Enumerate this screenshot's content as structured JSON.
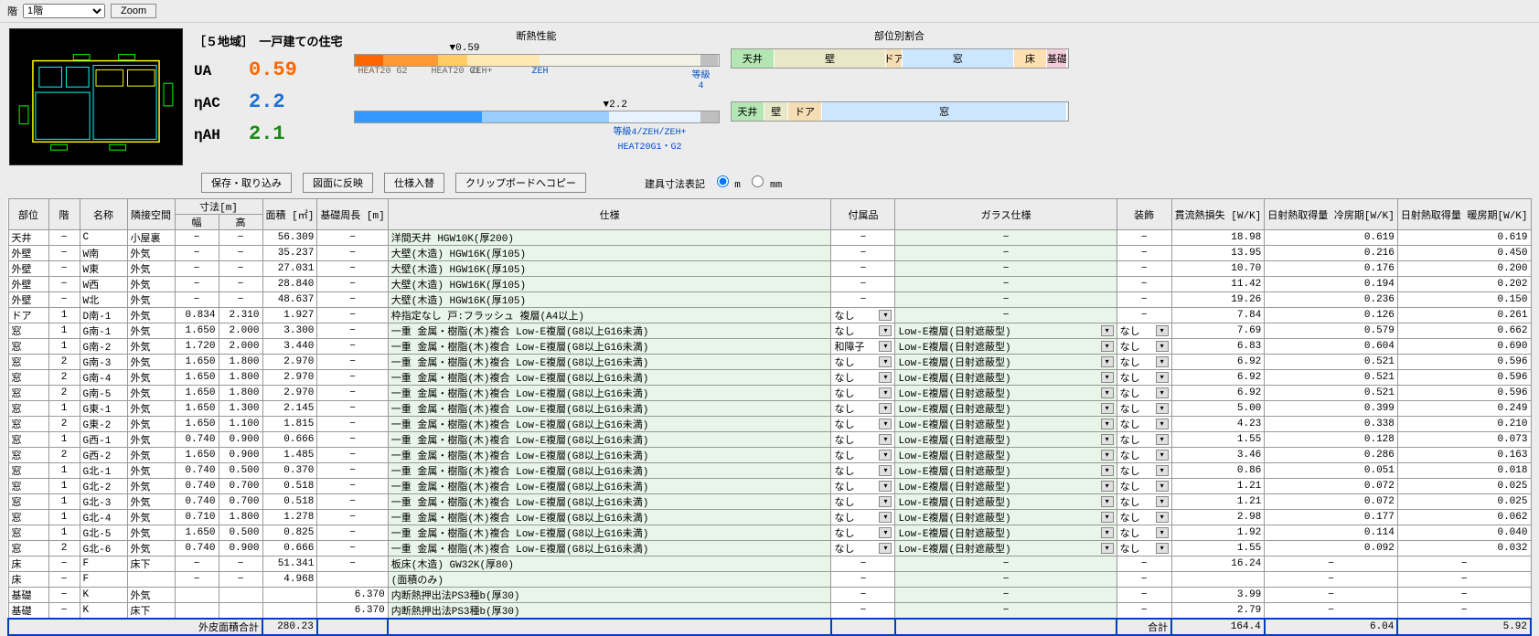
{
  "topbar": {
    "floor_label": "階",
    "floor_selected": "1階",
    "zoom": "Zoom"
  },
  "summary": {
    "title": "［５地域］　一戸建ての住宅",
    "ua_label": "UA",
    "ua_value": "0.59",
    "nac_label": "ηAC",
    "nac_value": "2.2",
    "nah_label": "ηAH",
    "nah_value": "2.1"
  },
  "gauge_ua": {
    "title": "断熱性能",
    "marker": "▼0.59",
    "ticks": [
      "HEAT20 G2",
      "HEAT20 G1",
      "ZEH+",
      "ZEH",
      "等級4"
    ]
  },
  "gauge_ac": {
    "marker": "▼2.2",
    "tick": "等級4/ZEH/ZEH+ HEAT20G1・G2"
  },
  "prop": {
    "title": "部位別割合",
    "bar1": [
      "天井",
      "壁",
      "ドア",
      "窓",
      "床",
      "基礎"
    ],
    "bar2": [
      "天井",
      "壁",
      "ドア",
      "窓"
    ]
  },
  "buttons": {
    "save": "保存・取り込み",
    "reflect": "図面に反映",
    "swap": "仕様入替",
    "clip": "クリップボードへコピー"
  },
  "radio": {
    "label": "建具寸法表記",
    "opt_m": "m",
    "opt_mm": "mm"
  },
  "headers": {
    "bui": "部位",
    "floor": "階",
    "name": "名称",
    "adj": "隣接空間",
    "dim": "寸法[m]",
    "dim_w": "幅",
    "dim_h": "高",
    "area": "面積 [㎡]",
    "peri": "基礎周長 [m]",
    "spec": "仕様",
    "acc": "付属品",
    "glass": "ガラス仕様",
    "deco": "装飾",
    "loss": "貫流熱損失 [W/K]",
    "cool": "日射熱取得量 冷房期[W/K]",
    "heat": "日射熱取得量 暖房期[W/K]"
  },
  "rows": [
    {
      "bui": "天井",
      "floor": "−",
      "name": "C",
      "adj": "小屋裏",
      "w": "−",
      "h": "−",
      "area": "56.309",
      "peri": "−",
      "spec": "洋間天井 HGW10K(厚200)",
      "acc": "−",
      "glass": "−",
      "deco": "−",
      "loss": "18.98",
      "cool": "0.619",
      "heat": "0.619"
    },
    {
      "bui": "外壁",
      "floor": "−",
      "name": "W南",
      "adj": "外気",
      "w": "−",
      "h": "−",
      "area": "35.237",
      "peri": "−",
      "spec": "大壁(木造) HGW16K(厚105)",
      "acc": "−",
      "glass": "−",
      "deco": "−",
      "loss": "13.95",
      "cool": "0.216",
      "heat": "0.450"
    },
    {
      "bui": "外壁",
      "floor": "−",
      "name": "W東",
      "adj": "外気",
      "w": "−",
      "h": "−",
      "area": "27.031",
      "peri": "−",
      "spec": "大壁(木造) HGW16K(厚105)",
      "acc": "−",
      "glass": "−",
      "deco": "−",
      "loss": "10.70",
      "cool": "0.176",
      "heat": "0.200"
    },
    {
      "bui": "外壁",
      "floor": "−",
      "name": "W西",
      "adj": "外気",
      "w": "−",
      "h": "−",
      "area": "28.840",
      "peri": "−",
      "spec": "大壁(木造) HGW16K(厚105)",
      "acc": "−",
      "glass": "−",
      "deco": "−",
      "loss": "11.42",
      "cool": "0.194",
      "heat": "0.202"
    },
    {
      "bui": "外壁",
      "floor": "−",
      "name": "W北",
      "adj": "外気",
      "w": "−",
      "h": "−",
      "area": "48.637",
      "peri": "−",
      "spec": "大壁(木造) HGW16K(厚105)",
      "acc": "−",
      "glass": "−",
      "deco": "−",
      "loss": "19.26",
      "cool": "0.236",
      "heat": "0.150"
    },
    {
      "bui": "ドア",
      "floor": "1",
      "name": "D南-1",
      "adj": "外気",
      "w": "0.834",
      "h": "2.310",
      "area": "1.927",
      "peri": "−",
      "spec": "枠指定なし 戸:フラッシュ 複層(A4以上)",
      "acc": "なし",
      "acc_dd": true,
      "glass": "−",
      "deco": "−",
      "loss": "7.84",
      "cool": "0.126",
      "heat": "0.261"
    },
    {
      "bui": "窓",
      "floor": "1",
      "name": "G南-1",
      "adj": "外気",
      "w": "1.650",
      "h": "2.000",
      "area": "3.300",
      "peri": "−",
      "spec": "一重 金属・樹脂(木)複合 Low-E複層(G8以上G16未満)",
      "acc": "なし",
      "acc_dd": true,
      "glass": "Low-E複層(日射遮蔽型)",
      "glass_dd": true,
      "deco": "なし",
      "deco_dd": true,
      "loss": "7.69",
      "cool": "0.579",
      "heat": "0.662"
    },
    {
      "bui": "窓",
      "floor": "1",
      "name": "G南-2",
      "adj": "外気",
      "w": "1.720",
      "h": "2.000",
      "area": "3.440",
      "peri": "−",
      "spec": "一重 金属・樹脂(木)複合 Low-E複層(G8以上G16未満)",
      "acc": "和障子",
      "acc_dd": true,
      "glass": "Low-E複層(日射遮蔽型)",
      "glass_dd": true,
      "deco": "なし",
      "deco_dd": true,
      "loss": "6.83",
      "cool": "0.604",
      "heat": "0.690"
    },
    {
      "bui": "窓",
      "floor": "2",
      "name": "G南-3",
      "adj": "外気",
      "w": "1.650",
      "h": "1.800",
      "area": "2.970",
      "peri": "−",
      "spec": "一重 金属・樹脂(木)複合 Low-E複層(G8以上G16未満)",
      "acc": "なし",
      "acc_dd": true,
      "glass": "Low-E複層(日射遮蔽型)",
      "glass_dd": true,
      "deco": "なし",
      "deco_dd": true,
      "loss": "6.92",
      "cool": "0.521",
      "heat": "0.596"
    },
    {
      "bui": "窓",
      "floor": "2",
      "name": "G南-4",
      "adj": "外気",
      "w": "1.650",
      "h": "1.800",
      "area": "2.970",
      "peri": "−",
      "spec": "一重 金属・樹脂(木)複合 Low-E複層(G8以上G16未満)",
      "acc": "なし",
      "acc_dd": true,
      "glass": "Low-E複層(日射遮蔽型)",
      "glass_dd": true,
      "deco": "なし",
      "deco_dd": true,
      "loss": "6.92",
      "cool": "0.521",
      "heat": "0.596"
    },
    {
      "bui": "窓",
      "floor": "2",
      "name": "G南-5",
      "adj": "外気",
      "w": "1.650",
      "h": "1.800",
      "area": "2.970",
      "peri": "−",
      "spec": "一重 金属・樹脂(木)複合 Low-E複層(G8以上G16未満)",
      "acc": "なし",
      "acc_dd": true,
      "glass": "Low-E複層(日射遮蔽型)",
      "glass_dd": true,
      "deco": "なし",
      "deco_dd": true,
      "loss": "6.92",
      "cool": "0.521",
      "heat": "0.596"
    },
    {
      "bui": "窓",
      "floor": "1",
      "name": "G東-1",
      "adj": "外気",
      "w": "1.650",
      "h": "1.300",
      "area": "2.145",
      "peri": "−",
      "spec": "一重 金属・樹脂(木)複合 Low-E複層(G8以上G16未満)",
      "acc": "なし",
      "acc_dd": true,
      "glass": "Low-E複層(日射遮蔽型)",
      "glass_dd": true,
      "deco": "なし",
      "deco_dd": true,
      "loss": "5.00",
      "cool": "0.399",
      "heat": "0.249"
    },
    {
      "bui": "窓",
      "floor": "2",
      "name": "G東-2",
      "adj": "外気",
      "w": "1.650",
      "h": "1.100",
      "area": "1.815",
      "peri": "−",
      "spec": "一重 金属・樹脂(木)複合 Low-E複層(G8以上G16未満)",
      "acc": "なし",
      "acc_dd": true,
      "glass": "Low-E複層(日射遮蔽型)",
      "glass_dd": true,
      "deco": "なし",
      "deco_dd": true,
      "loss": "4.23",
      "cool": "0.338",
      "heat": "0.210"
    },
    {
      "bui": "窓",
      "floor": "1",
      "name": "G西-1",
      "adj": "外気",
      "w": "0.740",
      "h": "0.900",
      "area": "0.666",
      "peri": "−",
      "spec": "一重 金属・樹脂(木)複合 Low-E複層(G8以上G16未満)",
      "acc": "なし",
      "acc_dd": true,
      "glass": "Low-E複層(日射遮蔽型)",
      "glass_dd": true,
      "deco": "なし",
      "deco_dd": true,
      "loss": "1.55",
      "cool": "0.128",
      "heat": "0.073"
    },
    {
      "bui": "窓",
      "floor": "2",
      "name": "G西-2",
      "adj": "外気",
      "w": "1.650",
      "h": "0.900",
      "area": "1.485",
      "peri": "−",
      "spec": "一重 金属・樹脂(木)複合 Low-E複層(G8以上G16未満)",
      "acc": "なし",
      "acc_dd": true,
      "glass": "Low-E複層(日射遮蔽型)",
      "glass_dd": true,
      "deco": "なし",
      "deco_dd": true,
      "loss": "3.46",
      "cool": "0.286",
      "heat": "0.163"
    },
    {
      "bui": "窓",
      "floor": "1",
      "name": "G北-1",
      "adj": "外気",
      "w": "0.740",
      "h": "0.500",
      "area": "0.370",
      "peri": "−",
      "spec": "一重 金属・樹脂(木)複合 Low-E複層(G8以上G16未満)",
      "acc": "なし",
      "acc_dd": true,
      "glass": "Low-E複層(日射遮蔽型)",
      "glass_dd": true,
      "deco": "なし",
      "deco_dd": true,
      "loss": "0.86",
      "cool": "0.051",
      "heat": "0.018"
    },
    {
      "bui": "窓",
      "floor": "1",
      "name": "G北-2",
      "adj": "外気",
      "w": "0.740",
      "h": "0.700",
      "area": "0.518",
      "peri": "−",
      "spec": "一重 金属・樹脂(木)複合 Low-E複層(G8以上G16未満)",
      "acc": "なし",
      "acc_dd": true,
      "glass": "Low-E複層(日射遮蔽型)",
      "glass_dd": true,
      "deco": "なし",
      "deco_dd": true,
      "loss": "1.21",
      "cool": "0.072",
      "heat": "0.025"
    },
    {
      "bui": "窓",
      "floor": "1",
      "name": "G北-3",
      "adj": "外気",
      "w": "0.740",
      "h": "0.700",
      "area": "0.518",
      "peri": "−",
      "spec": "一重 金属・樹脂(木)複合 Low-E複層(G8以上G16未満)",
      "acc": "なし",
      "acc_dd": true,
      "glass": "Low-E複層(日射遮蔽型)",
      "glass_dd": true,
      "deco": "なし",
      "deco_dd": true,
      "loss": "1.21",
      "cool": "0.072",
      "heat": "0.025"
    },
    {
      "bui": "窓",
      "floor": "1",
      "name": "G北-4",
      "adj": "外気",
      "w": "0.710",
      "h": "1.800",
      "area": "1.278",
      "peri": "−",
      "spec": "一重 金属・樹脂(木)複合 Low-E複層(G8以上G16未満)",
      "acc": "なし",
      "acc_dd": true,
      "glass": "Low-E複層(日射遮蔽型)",
      "glass_dd": true,
      "deco": "なし",
      "deco_dd": true,
      "loss": "2.98",
      "cool": "0.177",
      "heat": "0.062"
    },
    {
      "bui": "窓",
      "floor": "1",
      "name": "G北-5",
      "adj": "外気",
      "w": "1.650",
      "h": "0.500",
      "area": "0.825",
      "peri": "−",
      "spec": "一重 金属・樹脂(木)複合 Low-E複層(G8以上G16未満)",
      "acc": "なし",
      "acc_dd": true,
      "glass": "Low-E複層(日射遮蔽型)",
      "glass_dd": true,
      "deco": "なし",
      "deco_dd": true,
      "loss": "1.92",
      "cool": "0.114",
      "heat": "0.040"
    },
    {
      "bui": "窓",
      "floor": "2",
      "name": "G北-6",
      "adj": "外気",
      "w": "0.740",
      "h": "0.900",
      "area": "0.666",
      "peri": "−",
      "spec": "一重 金属・樹脂(木)複合 Low-E複層(G8以上G16未満)",
      "acc": "なし",
      "acc_dd": true,
      "glass": "Low-E複層(日射遮蔽型)",
      "glass_dd": true,
      "deco": "なし",
      "deco_dd": true,
      "loss": "1.55",
      "cool": "0.092",
      "heat": "0.032"
    },
    {
      "bui": "床",
      "floor": "−",
      "name": "F",
      "adj": "床下",
      "w": "−",
      "h": "−",
      "area": "51.341",
      "peri": "−",
      "spec": "板床(木造) GW32K(厚80)",
      "acc": "−",
      "glass": "−",
      "deco": "−",
      "loss": "16.24",
      "cool": "−",
      "heat": "−"
    },
    {
      "bui": "床",
      "floor": "−",
      "name": "F",
      "adj": "",
      "w": "−",
      "h": "−",
      "area": "4.968",
      "peri": "",
      "spec": "(面積のみ)",
      "acc": "−",
      "glass": "−",
      "deco": "−",
      "loss": "",
      "cool": "−",
      "heat": "−"
    },
    {
      "bui": "基礎",
      "floor": "−",
      "name": "K",
      "adj": "外気",
      "w": "",
      "h": "",
      "area": "",
      "peri": "6.370",
      "spec": "内断熱押出法PS3種b(厚30)",
      "acc": "−",
      "glass": "−",
      "deco": "−",
      "loss": "3.99",
      "cool": "−",
      "heat": "−"
    },
    {
      "bui": "基礎",
      "floor": "−",
      "name": "K",
      "adj": "床下",
      "w": "",
      "h": "",
      "area": "",
      "peri": "6.370",
      "spec": "内断熱押出法PS3種b(厚30)",
      "acc": "−",
      "glass": "−",
      "deco": "−",
      "loss": "2.79",
      "cool": "−",
      "heat": "−"
    }
  ],
  "totals": {
    "area_label": "外皮面積合計",
    "area": "280.23",
    "sum_label": "合計",
    "loss": "164.4",
    "cool": "6.04",
    "heat": "5.92"
  }
}
